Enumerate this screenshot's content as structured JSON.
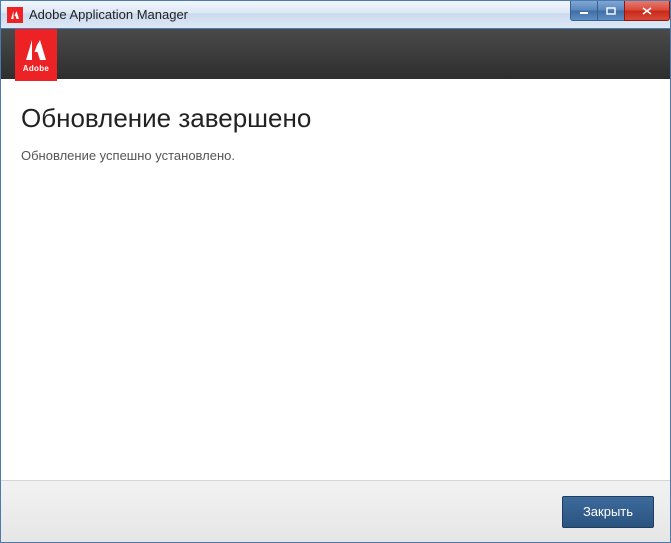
{
  "titlebar": {
    "title": "Adobe Application Manager"
  },
  "logo": {
    "brand": "Adobe"
  },
  "main": {
    "heading": "Обновление завершено",
    "message": "Обновление успешно установлено."
  },
  "footer": {
    "close_label": "Закрыть"
  }
}
